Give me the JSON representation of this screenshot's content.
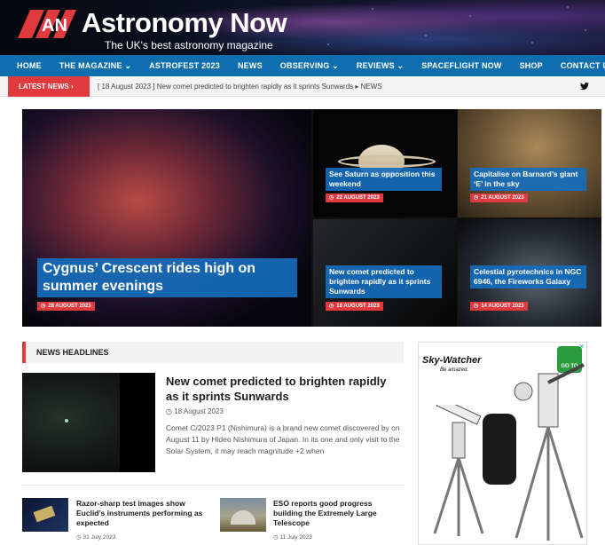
{
  "header": {
    "logo_text": "Astronomy Now",
    "tagline": "The UK's best astronomy magazine",
    "logo_mark": "AN"
  },
  "nav": {
    "items": [
      {
        "label": "HOME",
        "has_dropdown": false
      },
      {
        "label": "THE MAGAZINE ⌄",
        "has_dropdown": true
      },
      {
        "label": "ASTROFEST 2023",
        "has_dropdown": false
      },
      {
        "label": "NEWS",
        "has_dropdown": false
      },
      {
        "label": "OBSERVING ⌄",
        "has_dropdown": true
      },
      {
        "label": "REVIEWS ⌄",
        "has_dropdown": true
      },
      {
        "label": "SPACEFLIGHT NOW",
        "has_dropdown": false
      },
      {
        "label": "SHOP",
        "has_dropdown": false
      },
      {
        "label": "CONTACT US ⌄",
        "has_dropdown": true
      }
    ]
  },
  "ticker": {
    "label": "LATEST NEWS ›",
    "text": "[ 18 August 2023 ]  New comet predicted to brighten rapidly as it sprints Sunwards  ▸  NEWS"
  },
  "social": {
    "twitter_icon": "twitter-icon"
  },
  "featured": {
    "main": {
      "title": "Cygnus’ Crescent rides high on summer evenings",
      "date": "28 AUGUST 2023"
    },
    "saturn": {
      "title": "See Saturn as opposition this weekend",
      "date": "22 AUGUST 2023"
    },
    "barnard": {
      "title": "Capitalise on Barnard’s giant ‘E’ in the sky",
      "date": "21 AUGUST 2023"
    },
    "comet": {
      "title": "New comet predicted to brighten rapidly as it sprints Sunwards",
      "date": "18 AUGUST 2023"
    },
    "fireworks": {
      "title": "Celestial pyrotechnics in NGC 6946, the Fireworks Galaxy",
      "date": "14 AUGUST 2023"
    }
  },
  "news": {
    "section_title": "NEWS HEADLINES",
    "lead": {
      "title": "New comet predicted to brighten rapidly as it sprints Sunwards",
      "date": "18 August 2023",
      "excerpt": "Comet C/2023 P1 (Nishimura) is a brand new comet discovered by on August 11 by Hideo Nishimura of Japan. In its one and only visit to the Solar System, it may reach magnitude +2 when"
    },
    "small": [
      {
        "title": "Razor-sharp test images show Euclid’s instruments performing as expected",
        "date": "31 July 2023"
      },
      {
        "title": "ESO reports good progress building the Extremely Large Telescope",
        "date": "11 July 2023"
      }
    ]
  },
  "ad": {
    "brand": "Sky-Watcher",
    "slogan": "Be amazed.",
    "badge": "GO TO",
    "close": "✕"
  },
  "colors": {
    "nav": "#0f6fae",
    "accent": "#e03a3e",
    "caption": "#146ebe"
  }
}
